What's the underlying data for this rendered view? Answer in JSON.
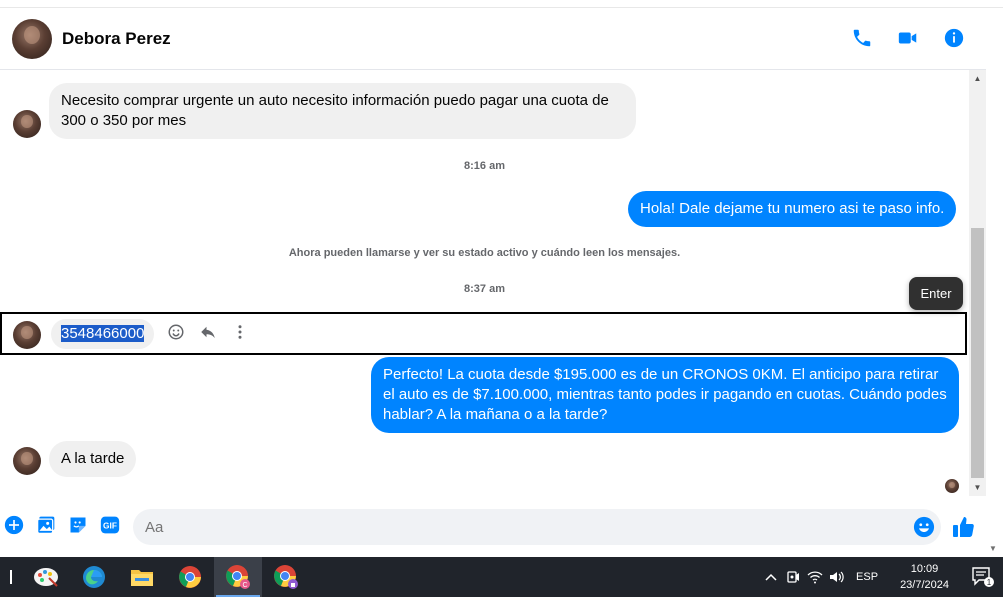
{
  "header": {
    "contact_name": "Debora Perez",
    "actions": [
      "phone-icon",
      "video-icon",
      "info-icon"
    ]
  },
  "messages": [
    {
      "direction": "in",
      "text": "Necesito comprar urgente un auto necesito información puedo pagar una cuota de 300 o 350 por mes"
    },
    {
      "type": "timestamp",
      "text": "8:16 am"
    },
    {
      "direction": "out",
      "text": "Hola! Dale dejame tu numero  asi te paso info."
    },
    {
      "type": "notice",
      "text": "Ahora pueden llamarse y ver su estado activo y cuándo leen los mensajes."
    },
    {
      "type": "timestamp",
      "text": "8:37 am"
    },
    {
      "direction": "in",
      "text": "3548466000",
      "selected": true
    },
    {
      "direction": "out",
      "text": "Perfecto! La cuota desde $195.000 es de un CRONOS 0KM. El anticipo para retirar el auto es de $7.100.000, mientras tanto podes ir pagando en cuotas. Cuándo podes hablar? A la mañana o a la tarde?"
    },
    {
      "direction": "in",
      "text": "A la tarde"
    }
  ],
  "tooltip": "Enter",
  "composer": {
    "placeholder": "Aa",
    "icons": [
      "plus-icon",
      "image-icon",
      "sticker-icon",
      "gif-icon"
    ],
    "gif_label": "GIF"
  },
  "colors": {
    "accent": "#0084ff",
    "incoming_bubble": "#f0f0f0",
    "taskbar": "#20242b"
  },
  "taskbar": {
    "language": "ESP",
    "time": "10:09",
    "date": "23/7/2024",
    "notifications": "1",
    "apps": [
      "paint-icon",
      "edge-icon",
      "file-explorer-icon",
      "chrome-icon",
      "chrome-profile-icon",
      "chrome-profile-2-icon"
    ]
  }
}
